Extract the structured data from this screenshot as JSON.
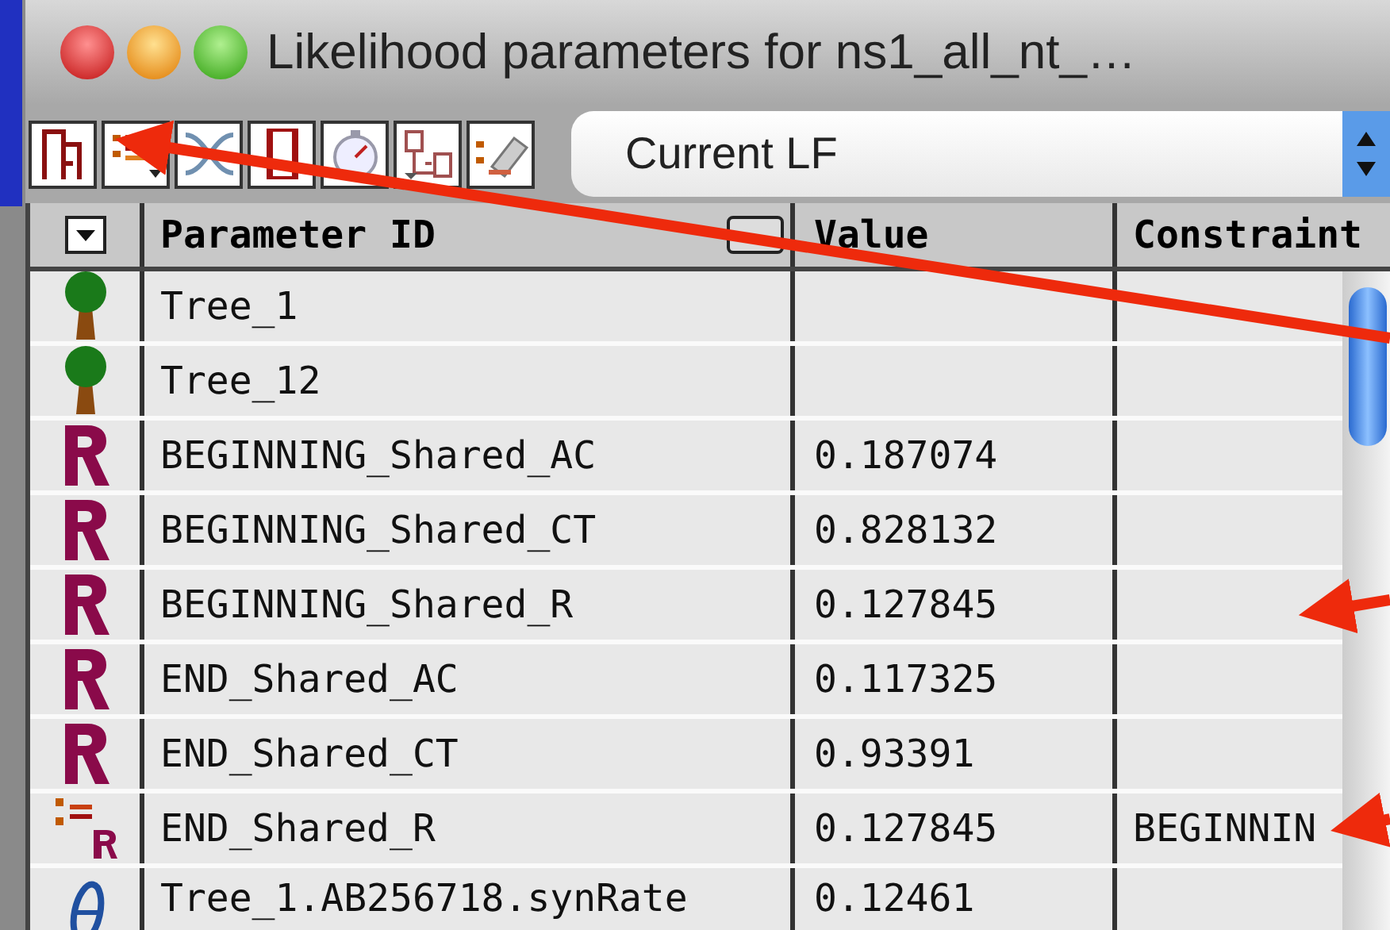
{
  "window": {
    "title": "Likelihood parameters for ns1_all_nt_…"
  },
  "toolbar": {
    "buttons": [
      {
        "kind": "tree"
      },
      {
        "kind": "list"
      },
      {
        "kind": "cross"
      },
      {
        "kind": "bookmark"
      },
      {
        "kind": "timer"
      },
      {
        "kind": "constrain"
      },
      {
        "kind": "eraser"
      }
    ],
    "popup": {
      "value": "Current LF"
    }
  },
  "table": {
    "columns": [
      "Parameter ID",
      "Value",
      "Constraint"
    ],
    "rows": [
      {
        "kind": "tree",
        "id": "Tree_1"
      },
      {
        "kind": "tree",
        "id": "Tree_12"
      },
      {
        "kind": "rate",
        "id": "BEGINNING_Shared_AC",
        "value": "0.187074"
      },
      {
        "kind": "rate",
        "id": "BEGINNING_Shared_CT",
        "value": "0.828132"
      },
      {
        "kind": "rate",
        "id": "BEGINNING_Shared_R",
        "value": "0.127845"
      },
      {
        "kind": "rate",
        "id": "END_Shared_AC",
        "value": "0.117325"
      },
      {
        "kind": "rate",
        "id": "END_Shared_CT",
        "value": "0.93391"
      },
      {
        "kind": "constrained",
        "id": "END_Shared_R",
        "value": "0.127845",
        "constraint": "BEGINNIN"
      },
      {
        "kind": "theta",
        "id": "Tree_1.AB256718.synRate",
        "value": "0.12461"
      }
    ]
  }
}
